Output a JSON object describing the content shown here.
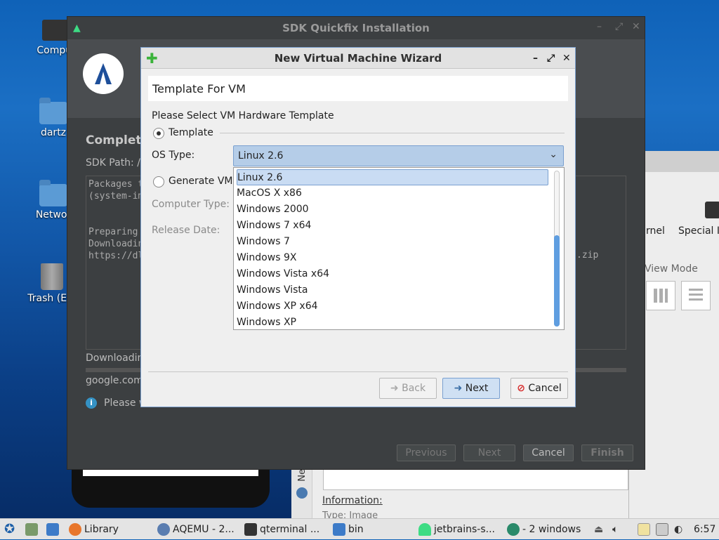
{
  "desktop": {
    "icons": [
      {
        "label": "Comput"
      },
      {
        "label": "dartz"
      },
      {
        "label": "Networ"
      },
      {
        "label": "Trash (Em"
      }
    ]
  },
  "bg_window": {
    "kernel_fragment": "rnel",
    "special_fragment": "Special In",
    "view_mode": "View Mode",
    "information": "Information:",
    "type_fragment": "Type: Image",
    "side_tab": "Ne"
  },
  "sdk": {
    "title": "SDK Quickfix Installation",
    "heading": "Completi",
    "sdk_path": "SDK Path:  /",
    "log_lines": [
      "Packages t",
      "(system-im",
      "",
      "",
      "Preparing",
      "Downloadin",
      "https://dl"
    ],
    "log_zip": ".zip",
    "downloading": "Downloadin",
    "url": "google.com/",
    "please_wait": "Please w",
    "buttons": {
      "previous": "Previous",
      "next": "Next",
      "cancel": "Cancel",
      "finish": "Finish"
    }
  },
  "wizard": {
    "title": "New Virtual Machine Wizard",
    "controls": {
      "minimize": "–",
      "maximize": "⤢",
      "close": "✕"
    },
    "header": "Template For VM",
    "prompt": "Please Select VM Hardware Template",
    "radio_template": "Template",
    "os_type_label": "OS Type:",
    "os_type_value": "Linux 2.6",
    "radio_generate": "Generate VM",
    "computer_type_label": "Computer Type:",
    "release_date_label": "Release Date:",
    "os_options": [
      "Linux 2.6",
      "MacOS X x86",
      "Windows 2000",
      "Windows 7 x64",
      "Windows 7",
      "Windows 9X",
      "Windows Vista x64",
      "Windows Vista",
      "Windows XP x64",
      "Windows XP"
    ],
    "buttons": {
      "back": "Back",
      "next": "Next",
      "cancel": "Cancel"
    }
  },
  "taskbar": {
    "library": "Library",
    "aqemu": "AQEMU - 2...",
    "qterminal": "qterminal ...",
    "bin": "bin",
    "jetbrains": "jetbrains-s...",
    "windows": "- 2 windows",
    "clock": "6:57"
  },
  "colors": {
    "accent": "#7aa0d0",
    "selection": "#b5cde8",
    "cancel_red": "#d62b2b",
    "android_green": "#3ddc84"
  }
}
